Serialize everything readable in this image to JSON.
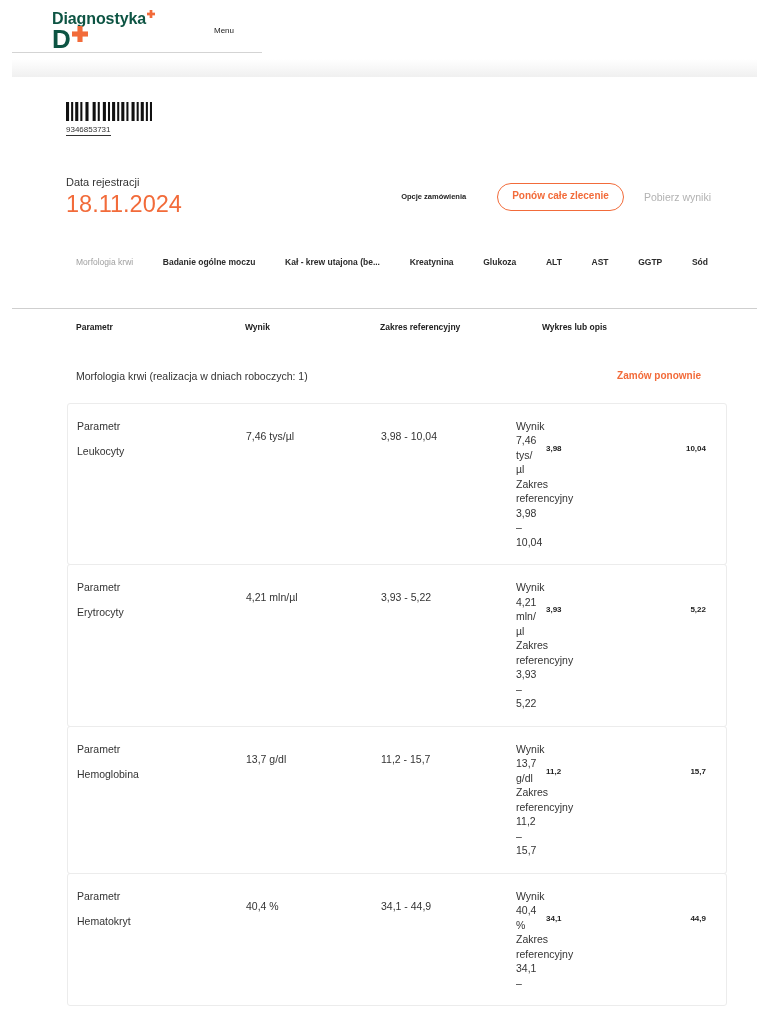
{
  "header": {
    "brand": {
      "name": "Diagnostyka",
      "mark": "D"
    },
    "menu": "Menu"
  },
  "order": {
    "barcode_number": "9346853731",
    "date_label": "Data rejestracji",
    "date": "18.11.2024",
    "options_label": "Opcje zamówienia",
    "actions": [
      {
        "label": "Ponów całe zlecenie",
        "kind": "outline",
        "disabled": false
      },
      {
        "label": "Pobierz wyniki",
        "kind": "link",
        "disabled": true
      }
    ]
  },
  "tabs": [
    {
      "label": "Morfologia krwi",
      "selected": true
    },
    {
      "label": "Badanie ogólne moczu",
      "selected": false
    },
    {
      "label": "Kał - krew utajona (be...",
      "selected": false
    },
    {
      "label": "Kreatynina",
      "selected": false
    },
    {
      "label": "Glukoza",
      "selected": false
    },
    {
      "label": "ALT",
      "selected": false
    },
    {
      "label": "AST",
      "selected": false
    },
    {
      "label": "GGTP",
      "selected": false
    },
    {
      "label": "Sód",
      "selected": false
    }
  ],
  "table": {
    "columns": [
      "Parametr",
      "Wynik",
      "Zakres referencyjny",
      "Wykres lub opis"
    ],
    "sections": [
      {
        "title": "Morfologia krwi (realizacja w dniach roboczych: 1)",
        "action": "Zamów ponownie",
        "rows": [
          {
            "label": "Parametr",
            "name": "Leukocyty",
            "result": "7,46 tys/µl",
            "range": "3,98 - 10,04",
            "chart": {
              "result_label": "Wynik",
              "result": "7,46 tys/µl",
              "range_label": "Zakres referencyjny",
              "range": "3,98 – 10,04",
              "min": "3,98",
              "max": "10,04"
            }
          },
          {
            "label": "Parametr",
            "name": "Erytrocyty",
            "result": "4,21 mln/µl",
            "range": "3,93 - 5,22",
            "chart": {
              "result_label": "Wynik",
              "result": "4,21 mln/µl",
              "range_label": "Zakres referencyjny",
              "range": "3,93 – 5,22",
              "min": "3,93",
              "max": "5,22"
            }
          },
          {
            "label": "Parametr",
            "name": "Hemoglobina",
            "result": "13,7 g/dl",
            "range": "11,2 - 15,7",
            "chart": {
              "result_label": "Wynik",
              "result": "13,7 g/dl",
              "range_label": "Zakres referencyjny",
              "range": "11,2 – 15,7",
              "min": "11,2",
              "max": "15,7"
            }
          },
          {
            "label": "Parametr",
            "name": "Hematokryt",
            "result": "40,4 %",
            "range": "34,1 - 44,9",
            "chart": {
              "result_label": "Wynik",
              "result": "40,4 %",
              "range_label": "Zakres referencyjny",
              "range": "34,1 –",
              "min": "34,1",
              "max": "44,9"
            }
          }
        ]
      }
    ]
  }
}
